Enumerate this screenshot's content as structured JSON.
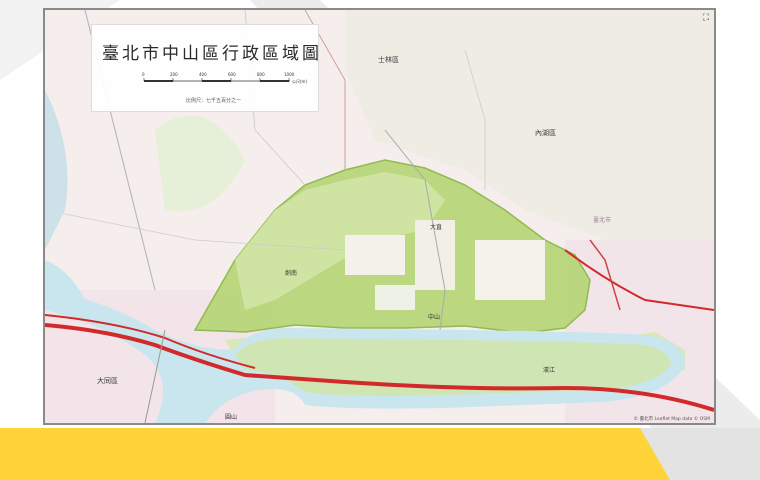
{
  "map": {
    "title": "臺北市中山區行政區域圖",
    "scale_ticks": [
      "0",
      "200",
      "400",
      "600",
      "800",
      "1000"
    ],
    "scale_unit": "公尺(m)",
    "note": "比例尺：七千五百分之一",
    "attribution": "© 臺北市  Leaflet Map data © OSM",
    "fullscreen_symbol": "⛶",
    "area_labels": {
      "shilin": "士林區",
      "neihu": "內湖區",
      "datong": "大同區",
      "taipei": "臺北市",
      "dazhi": "大直",
      "yuanshan": "圓山",
      "jiannan": "劍南",
      "zhongshan": "中山",
      "binjiang": "濱江"
    },
    "colors": {
      "district_fill": "#b8d67a",
      "district_border": "#8cb84a",
      "river": "#c9e6ef",
      "highway": "#d22a2a",
      "band_yellow": "#ffd43b",
      "stripe_grey": "#ebebeb"
    }
  }
}
